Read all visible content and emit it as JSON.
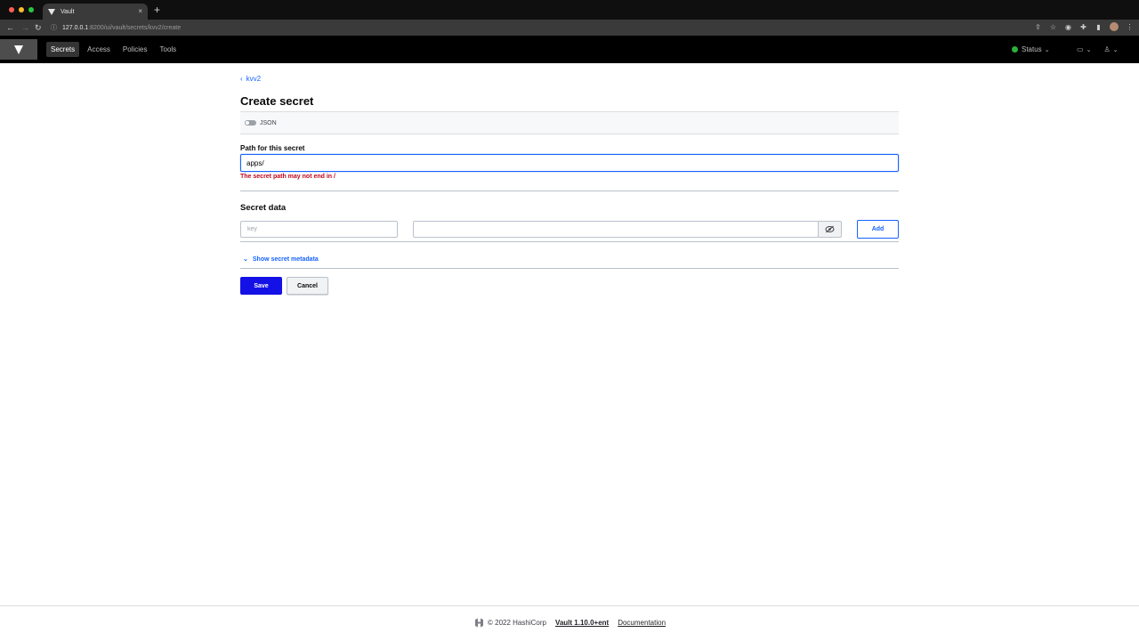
{
  "browser": {
    "tab_title": "Vault",
    "tab_close": "×",
    "new_tab": "+",
    "url_host": "127.0.0.1",
    "url_rest": ":8200/ui/vault/secrets/kvv2/create"
  },
  "nav": {
    "items": [
      {
        "label": "Secrets",
        "active": true
      },
      {
        "label": "Access"
      },
      {
        "label": "Policies"
      },
      {
        "label": "Tools"
      }
    ],
    "status_label": "Status",
    "status_color": "#2eb039"
  },
  "breadcrumb": {
    "label": "kvv2"
  },
  "page": {
    "title": "Create secret"
  },
  "json_toggle": {
    "label": "JSON",
    "on": false
  },
  "path": {
    "label": "Path for this secret",
    "value": "apps/",
    "error": "The secret path may not end in /"
  },
  "secret_data": {
    "title": "Secret data",
    "key_placeholder": "key",
    "value": "",
    "add_label": "Add"
  },
  "metadata": {
    "label": "Show secret metadata"
  },
  "actions": {
    "save_label": "Save",
    "cancel_label": "Cancel"
  },
  "footer": {
    "copyright": "© 2022 HashiCorp",
    "version": "Vault 1.10.0+ent",
    "docs": "Documentation"
  },
  "colors": {
    "accent": "#1563ff",
    "primary_button": "#1411e6",
    "error": "#c2051a"
  }
}
